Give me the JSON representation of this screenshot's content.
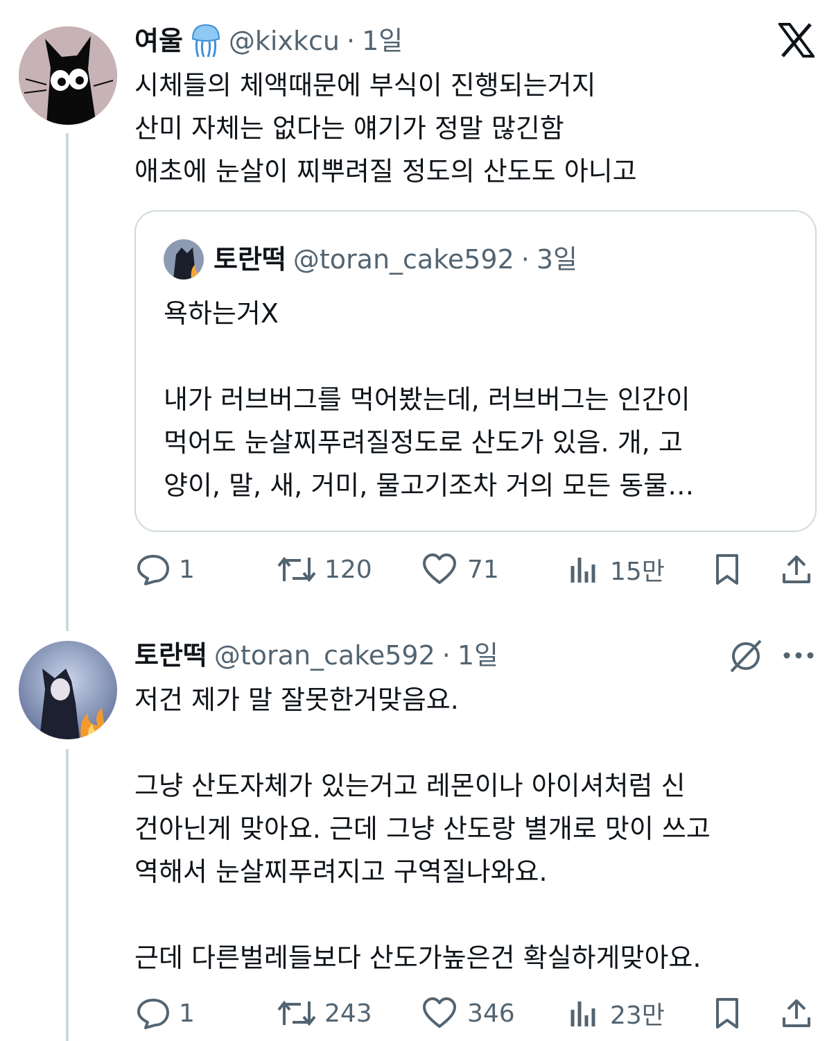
{
  "tweet1": {
    "name": "여울",
    "handle": "@kixkcu",
    "sep": "·",
    "time": "1일",
    "text": "시체들의 체액때문에 부식이 진행되는거지\n산미 자체는 없다는 얘기가 정말 많긴함\n애초에 눈살이 찌뿌려질 정도의 산도도 아니고",
    "quote": {
      "name": "토란떡",
      "handle": "@toran_cake592",
      "sep": "·",
      "time": "3일",
      "text": "욕하는거X\n\n내가 러브버그를 먹어봤는데, 러브버그는 인간이\n먹어도 눈살찌푸려질정도로 산도가 있음. 개, 고\n양이, 말, 새, 거미, 물고기조차 거의 모든 동물…"
    },
    "metrics": {
      "replies": "1",
      "reposts": "120",
      "likes": "71",
      "views": "15만"
    }
  },
  "tweet2": {
    "name": "토란떡",
    "handle": "@toran_cake592",
    "sep": "·",
    "time": "1일",
    "text": "저건 제가 말 잘못한거맞음요.\n\n그냥 산도자체가 있는거고 레몬이나 아이셔처럼 신\n건아닌게 맞아요. 근데 그냥 산도랑 별개로 맛이 쓰고\n역해서 눈살찌푸려지고 구역질나와요.\n\n근데 다른벌레들보다 산도가높은건 확실하게맞아요.",
    "metrics": {
      "replies": "1",
      "reposts": "243",
      "likes": "346",
      "views": "23만"
    }
  },
  "icons": {
    "brand": "x-logo-icon",
    "jellyfish": "jellyfish-emoji-icon",
    "reply": "reply-icon",
    "repost": "repost-icon",
    "like": "heart-icon",
    "views": "views-icon",
    "bookmark": "bookmark-icon",
    "share": "share-icon",
    "grok": "grok-icon",
    "more": "more-icon"
  },
  "colors": {
    "text": "#0f1419",
    "secondary": "#536471",
    "border": "#cfd9de"
  }
}
